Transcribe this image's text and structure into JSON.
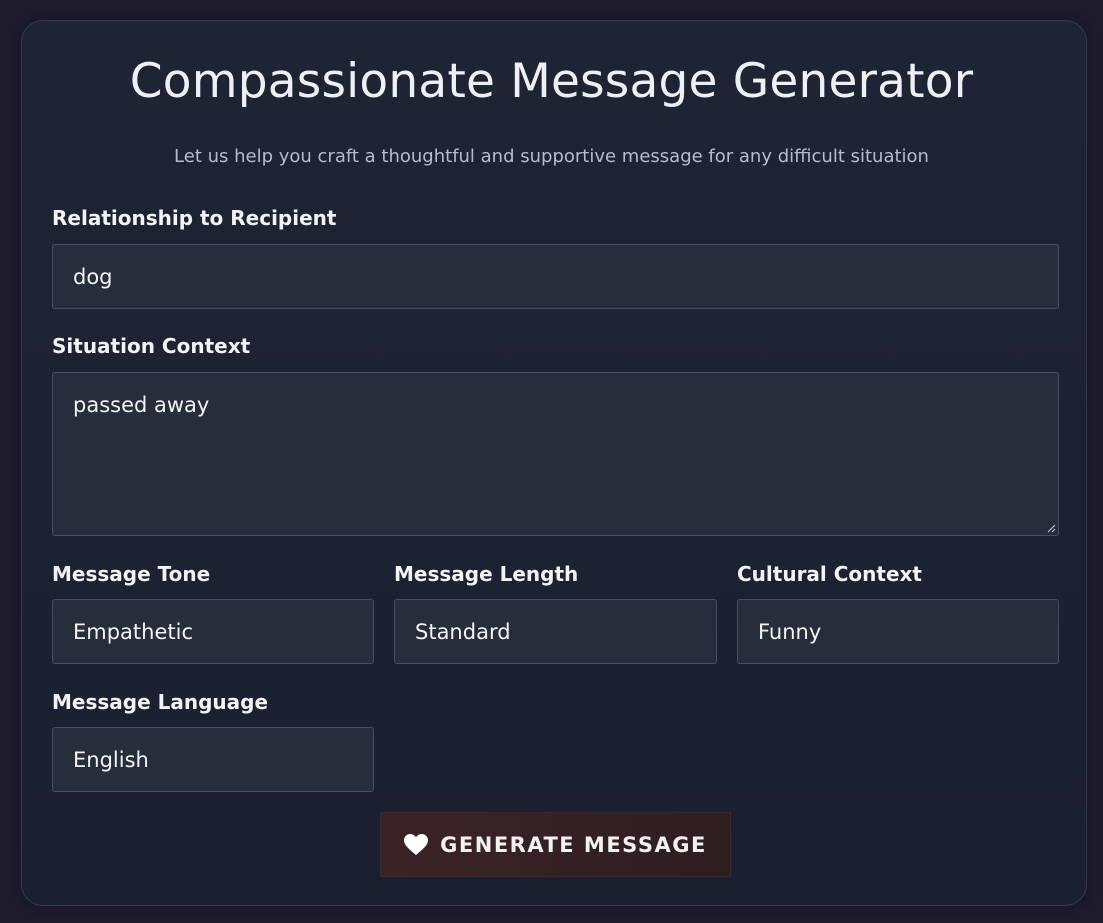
{
  "title": "Compassionate Message Generator",
  "subtitle": "Let us help you craft a thoughtful and supportive message for any difficult situation",
  "fields": {
    "relationship": {
      "label": "Relationship to Recipient",
      "value": "dog"
    },
    "situation": {
      "label": "Situation Context",
      "value": "passed away"
    },
    "tone": {
      "label": "Message Tone",
      "value": "Empathetic"
    },
    "length": {
      "label": "Message Length",
      "value": "Standard"
    },
    "cultural": {
      "label": "Cultural Context",
      "value": "Funny"
    },
    "language": {
      "label": "Message Language",
      "value": "English"
    }
  },
  "button": {
    "label": "GENERATE MESSAGE",
    "icon": "heart-icon"
  },
  "colors": {
    "background": "#1e1c2d",
    "card": "#1f2434",
    "field": "#282d3b",
    "button": "#3a2325"
  }
}
